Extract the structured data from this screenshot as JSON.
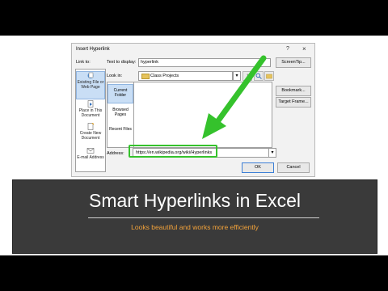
{
  "dialog": {
    "title": "Insert Hyperlink",
    "help": "?",
    "close": "×",
    "link_to_label": "Link to:",
    "text_to_display_label": "Text to display:",
    "text_to_display_value": "hyperlink",
    "screentip_button": "ScreenTip...",
    "look_in_label": "Look in:",
    "look_in_value": "Class Projects",
    "bookmark_button": "Bookmark...",
    "target_frame_button": "Target Frame...",
    "link_bar": [
      {
        "label": "Existing File or Web Page",
        "icon": "existing-file-icon"
      },
      {
        "label": "Place in This Document",
        "icon": "place-in-document-icon"
      },
      {
        "label": "Create New Document",
        "icon": "new-document-icon"
      },
      {
        "label": "E-mail Address",
        "icon": "email-icon"
      }
    ],
    "side_nav": [
      "Current Folder",
      "Browsed Pages",
      "Recent Files"
    ],
    "address_label": "Address:",
    "address_value": "https://en.wikipedia.org/wiki/Hyperlinks",
    "ok_button": "OK",
    "cancel_button": "Cancel"
  },
  "banner": {
    "title": "Smart Hyperlinks in Excel",
    "subtitle": "Looks beautiful and works more efficiently"
  },
  "colors": {
    "highlight": "#35c22c",
    "banner_bg": "#3a3a3a",
    "subtitle": "#f2a23a"
  }
}
